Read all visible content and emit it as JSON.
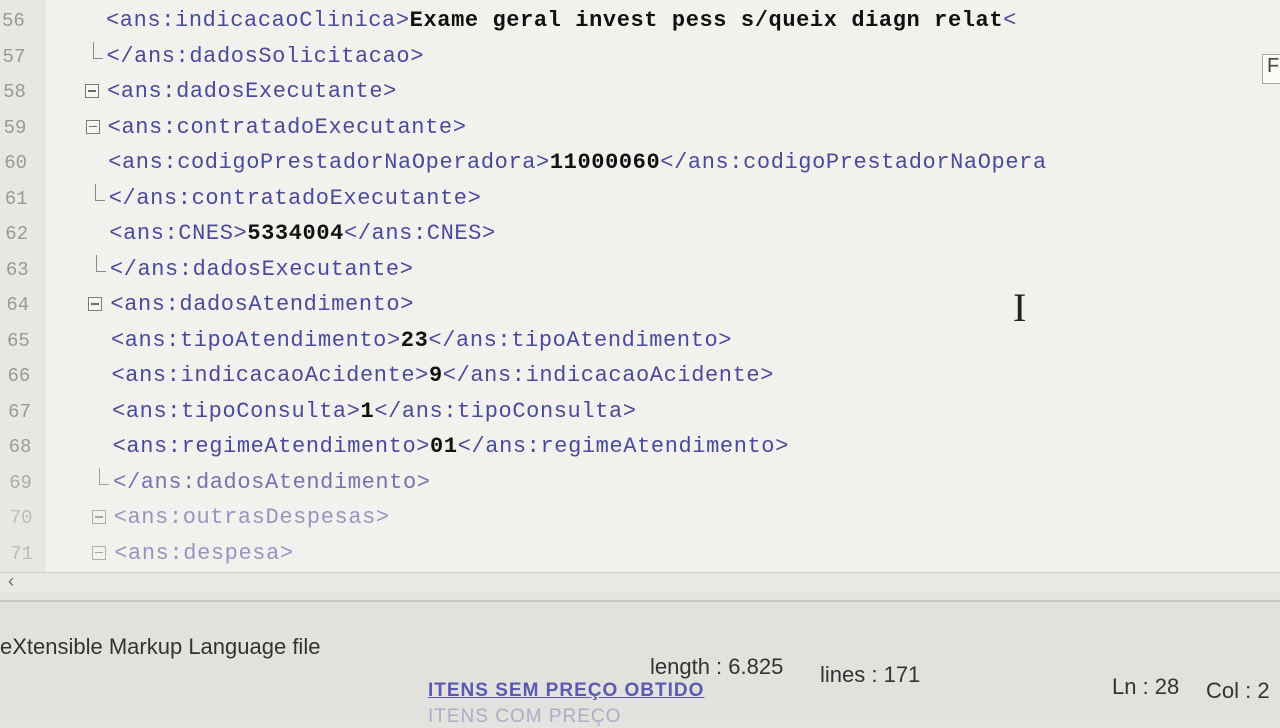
{
  "editor": {
    "lines": [
      {
        "no": "56",
        "fold": "none",
        "indent": 106,
        "tag_open": "<ans:indicacaoClinica>",
        "value": "Exame geral invest pess s/queix diagn relat",
        "tag_close": "<"
      },
      {
        "no": "57",
        "fold": "end",
        "indent": 106,
        "tag_open": "</ans:dadosSolicitacao>",
        "value": "",
        "tag_close": ""
      },
      {
        "no": "58",
        "fold": "box",
        "indent": 106,
        "tag_open": "<ans:dadosExecutante>",
        "value": "",
        "tag_close": ""
      },
      {
        "no": "59",
        "fold": "box",
        "indent": 106,
        "tag_open": "<ans:contratadoExecutante>",
        "value": "",
        "tag_close": ""
      },
      {
        "no": "60",
        "fold": "none",
        "indent": 106,
        "tag_open": "<ans:codigoPrestadorNaOperadora>",
        "value": "11000060",
        "tag_close": "</ans:codigoPrestadorNaOpera"
      },
      {
        "no": "61",
        "fold": "end",
        "indent": 106,
        "tag_open": "</ans:contratadoExecutante>",
        "value": "",
        "tag_close": ""
      },
      {
        "no": "62",
        "fold": "none",
        "indent": 106,
        "tag_open": "<ans:CNES>",
        "value": "5334004",
        "tag_close": "</ans:CNES>"
      },
      {
        "no": "63",
        "fold": "end",
        "indent": 106,
        "tag_open": "</ans:dadosExecutante>",
        "value": "",
        "tag_close": ""
      },
      {
        "no": "64",
        "fold": "box",
        "indent": 106,
        "tag_open": "<ans:dadosAtendimento>",
        "value": "",
        "tag_close": ""
      },
      {
        "no": "65",
        "fold": "none",
        "indent": 106,
        "tag_open": "<ans:tipoAtendimento>",
        "value": "23",
        "tag_close": "</ans:tipoAtendimento>"
      },
      {
        "no": "66",
        "fold": "none",
        "indent": 106,
        "tag_open": "<ans:indicacaoAcidente>",
        "value": "9",
        "tag_close": "</ans:indicacaoAcidente>"
      },
      {
        "no": "67",
        "fold": "none",
        "indent": 106,
        "tag_open": "<ans:tipoConsulta>",
        "value": "1",
        "tag_close": "</ans:tipoConsulta>"
      },
      {
        "no": "68",
        "fold": "none",
        "indent": 106,
        "tag_open": "<ans:regimeAtendimento>",
        "value": "01",
        "tag_close": "</ans:regimeAtendimento>"
      },
      {
        "no": "69",
        "fold": "end",
        "indent": 106,
        "tag_open": "</ans:dadosAtendimento>",
        "value": "",
        "tag_close": ""
      },
      {
        "no": "70",
        "fold": "box",
        "indent": 106,
        "tag_open": "<ans:outrasDespesas>",
        "value": "",
        "tag_close": ""
      },
      {
        "no": "71",
        "fold": "box",
        "indent": 106,
        "tag_open": "<ans:despesa>",
        "value": "",
        "tag_close": ""
      }
    ],
    "tooltip_char": "F"
  },
  "statusbar": {
    "file_type": "eXtensible Markup Language file",
    "length": "length : 6.825",
    "lines": "lines : 171",
    "ln": "Ln : 28",
    "col": "Col : 2"
  },
  "background": {
    "link1": "ITENS SEM PREÇO OBTIDO",
    "link2": "ITENS COM PREÇO"
  }
}
